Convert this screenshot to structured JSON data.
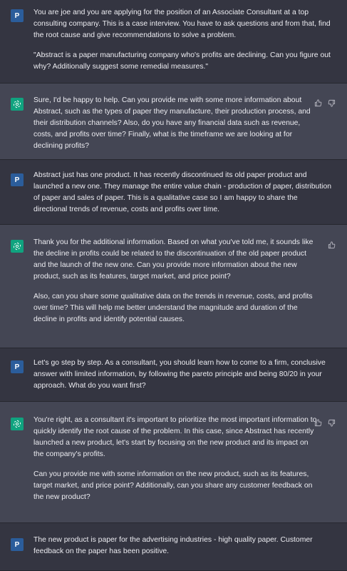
{
  "user_avatar_letter": "P",
  "messages": [
    {
      "role": "user",
      "paragraphs": [
        "You are joe and you are applying for the position of an Associate Consultant at a top consulting company. This is a case interview. You have to ask questions and from that, find the root cause and give recommendations to solve a problem.",
        "\"Abstract is a paper manufacturing company who's profits are declining. Can you figure out why? Additionally suggest some remedial measures.\""
      ]
    },
    {
      "role": "assistant",
      "paragraphs": [
        "Sure, I'd be happy to help. Can you provide me with some more information about Abstract, such as the types of paper they manufacture, their production process, and their distribution channels? Also, do you have any financial data such as revenue, costs, and profits over time? Finally, what is the timeframe we are looking at for declining profits?"
      ]
    },
    {
      "role": "user",
      "paragraphs": [
        "Abstract just has one product. It has recently discontinued its old paper product and launched a new one. They manage the entire value chain - production of paper, distribution of paper and sales of paper. This is a qualitative case so I am happy to share the directional trends of revenue, costs and profits over time."
      ]
    },
    {
      "role": "assistant",
      "paragraphs": [
        "Thank you for the additional information. Based on what you've told me, it sounds like the decline in profits could be related to the discontinuation of the old paper product and the launch of the new one. Can you provide more information about the new product, such as its features, target market, and price point?",
        "Also, can you share some qualitative data on the trends in revenue, costs, and profits over time? This will help me better understand the magnitude and duration of the decline in profits and identify potential causes."
      ]
    },
    {
      "role": "user",
      "paragraphs": [
        "Let's go step by step. As a consultant, you should learn how to come to a firm, conclusive answer with limited information, by following the pareto principle and being 80/20 in your approach. What do you want first?"
      ]
    },
    {
      "role": "assistant",
      "paragraphs": [
        "You're right, as a consultant it's important to prioritize the most important information to quickly identify the root cause of the problem. In this case, since Abstract has recently launched a new product, let's start by focusing on the new product and its impact on the company's profits.",
        "Can you provide me with some information on the new product, such as its features, target market, and price point? Additionally, can you share any customer feedback on the new product?"
      ]
    },
    {
      "role": "user",
      "paragraphs": [
        "The new product is paper for the advertising industries - high quality paper. Customer feedback on the paper has been positive."
      ]
    }
  ]
}
